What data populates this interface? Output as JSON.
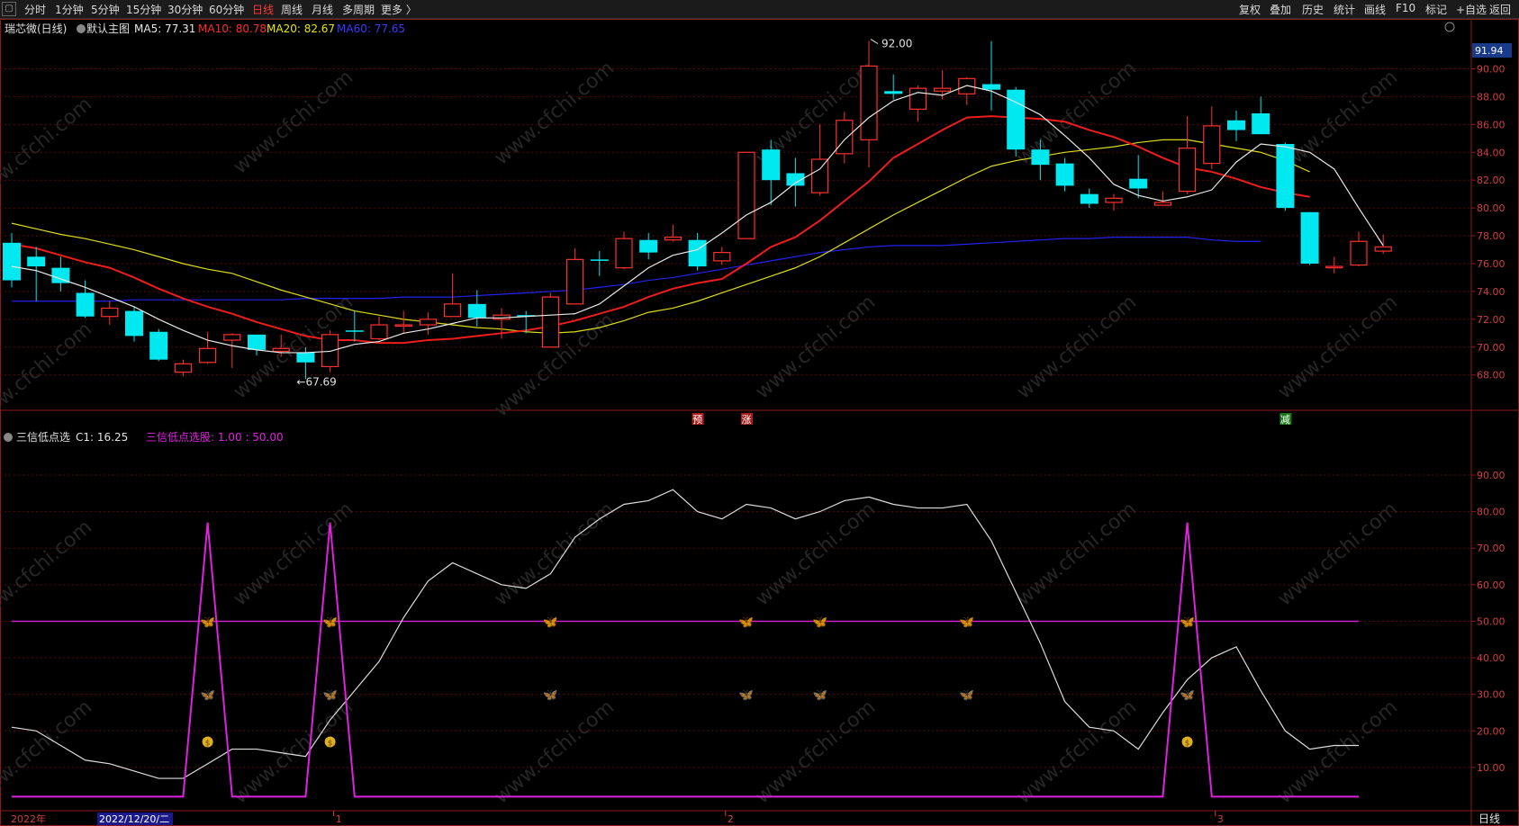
{
  "toolbar": {
    "periods": [
      "分时",
      "1分钟",
      "5分钟",
      "15分钟",
      "30分钟",
      "60分钟",
      "日线",
      "周线",
      "月线",
      "多周期",
      "更多 〉"
    ],
    "active_period": "日线",
    "right_buttons": [
      "复权",
      "叠加",
      "历史",
      "统计",
      "画线",
      "F10",
      "标记",
      "+自选",
      "返回"
    ]
  },
  "main_panel": {
    "stock_name": "瑞芯微(日线)",
    "template": "默认主图",
    "ma_labels": [
      {
        "text": "MA5: 77.31",
        "color": "#e8e8e8"
      },
      {
        "text": "MA10: 80.78",
        "color": "#ff2a2a"
      },
      {
        "text": "MA20: 82.67",
        "color": "#e8e800"
      },
      {
        "text": "MA60: 77.65",
        "color": "#3a3aff"
      }
    ],
    "current_price_tag": "91.94",
    "y_axis_labels": [
      "90.00",
      "88.00",
      "86.00",
      "84.00",
      "82.00",
      "80.00",
      "78.00",
      "76.00",
      "74.00",
      "72.00",
      "70.00",
      "68.00"
    ],
    "high_annotation": "92.00",
    "low_annotation": "67.69",
    "event_markers": [
      {
        "text": "预",
        "index": 28
      },
      {
        "text": "涨",
        "index": 30
      },
      {
        "text": "减",
        "index": 52
      }
    ]
  },
  "sub_panel": {
    "indicator_name": "三信低点选",
    "c1_label": "C1: 16.25",
    "signal_label": "三信低点选股: 1.00 : 50.00",
    "y_axis_labels": [
      "90.00",
      "80.00",
      "70.00",
      "60.00",
      "50.00",
      "40.00",
      "30.00",
      "20.00",
      "10.00"
    ],
    "reference_line": 50
  },
  "x_axis": {
    "year_label": "2022年",
    "cursor_date": "2022/12/20/二",
    "month_ticks": [
      {
        "text": "1",
        "index": 13
      },
      {
        "text": "2",
        "index": 29
      },
      {
        "text": "3",
        "index": 49
      }
    ],
    "period_button": "日线"
  },
  "watermark": "www.cfchi.com",
  "chart_data": {
    "type": "candlestick",
    "ylim": [
      67,
      93
    ],
    "candles": [
      {
        "o": 77.5,
        "h": 78.2,
        "c": 74.8,
        "l": 74.3
      },
      {
        "o": 76.5,
        "h": 77.2,
        "c": 75.8,
        "l": 73.3
      },
      {
        "o": 75.7,
        "h": 76.5,
        "c": 74.6,
        "l": 74.0
      },
      {
        "o": 73.9,
        "h": 74.8,
        "c": 72.2,
        "l": 72.1
      },
      {
        "o": 72.2,
        "h": 73.3,
        "c": 72.8,
        "l": 71.6
      },
      {
        "o": 72.6,
        "h": 72.9,
        "c": 70.8,
        "l": 70.4
      },
      {
        "o": 71.1,
        "h": 71.3,
        "c": 69.1,
        "l": 69.0
      },
      {
        "o": 68.2,
        "h": 69.1,
        "c": 68.8,
        "l": 67.9
      },
      {
        "o": 68.9,
        "h": 71.1,
        "c": 69.9,
        "l": 68.8
      },
      {
        "o": 70.5,
        "h": 71.0,
        "c": 70.9,
        "l": 68.5
      },
      {
        "o": 70.9,
        "h": 70.9,
        "c": 69.8,
        "l": 69.4
      },
      {
        "o": 69.7,
        "h": 70.9,
        "c": 69.9,
        "l": 69.3
      },
      {
        "o": 69.6,
        "h": 70.0,
        "c": 68.9,
        "l": 67.7
      },
      {
        "o": 68.6,
        "h": 71.2,
        "c": 70.9,
        "l": 68.2
      },
      {
        "o": 71.2,
        "h": 72.6,
        "c": 71.1,
        "l": 70.4
      },
      {
        "o": 70.6,
        "h": 72.2,
        "c": 71.6,
        "l": 70.5
      },
      {
        "o": 71.6,
        "h": 72.6,
        "c": 71.6,
        "l": 71.0
      },
      {
        "o": 71.6,
        "h": 72.5,
        "c": 72.0,
        "l": 70.9
      },
      {
        "o": 72.2,
        "h": 75.3,
        "c": 73.1,
        "l": 72.3
      },
      {
        "o": 73.1,
        "h": 74.1,
        "c": 72.1,
        "l": 71.5
      },
      {
        "o": 72.0,
        "h": 72.8,
        "c": 72.3,
        "l": 70.6
      },
      {
        "o": 72.3,
        "h": 72.6,
        "c": 72.2,
        "l": 71.0
      },
      {
        "o": 70.0,
        "h": 73.9,
        "c": 73.6,
        "l": 70.0
      },
      {
        "o": 73.1,
        "h": 77.1,
        "c": 76.3,
        "l": 73.2
      },
      {
        "o": 76.3,
        "h": 76.9,
        "c": 76.2,
        "l": 75.1
      },
      {
        "o": 75.7,
        "h": 78.3,
        "c": 77.8,
        "l": 75.6
      },
      {
        "o": 77.7,
        "h": 78.2,
        "c": 76.8,
        "l": 76.3
      },
      {
        "o": 77.7,
        "h": 78.8,
        "c": 77.9,
        "l": 77.6
      },
      {
        "o": 77.7,
        "h": 78.2,
        "c": 75.8,
        "l": 75.5
      },
      {
        "o": 76.2,
        "h": 77.2,
        "c": 76.8,
        "l": 75.9
      },
      {
        "o": 77.8,
        "h": 84.0,
        "c": 84.0,
        "l": 77.8
      },
      {
        "o": 84.2,
        "h": 84.9,
        "c": 82.0,
        "l": 80.2
      },
      {
        "o": 82.5,
        "h": 83.6,
        "c": 81.6,
        "l": 80.1
      },
      {
        "o": 81.1,
        "h": 86.0,
        "c": 83.5,
        "l": 80.9
      },
      {
        "o": 83.9,
        "h": 86.9,
        "c": 86.3,
        "l": 83.2
      },
      {
        "o": 84.9,
        "h": 92.0,
        "c": 90.2,
        "l": 82.9
      },
      {
        "o": 88.4,
        "h": 89.6,
        "c": 88.2,
        "l": 87.8
      },
      {
        "o": 87.1,
        "h": 88.8,
        "c": 88.6,
        "l": 86.2
      },
      {
        "o": 88.4,
        "h": 89.9,
        "c": 88.6,
        "l": 87.8
      },
      {
        "o": 88.2,
        "h": 89.4,
        "c": 89.3,
        "l": 87.4
      },
      {
        "o": 88.9,
        "h": 92.0,
        "c": 88.5,
        "l": 87.0
      },
      {
        "o": 88.5,
        "h": 88.7,
        "c": 84.2,
        "l": 83.7
      },
      {
        "o": 84.2,
        "h": 84.9,
        "c": 83.1,
        "l": 82.0
      },
      {
        "o": 83.2,
        "h": 83.6,
        "c": 81.6,
        "l": 81.2
      },
      {
        "o": 81.0,
        "h": 81.4,
        "c": 80.3,
        "l": 80.0
      },
      {
        "o": 80.4,
        "h": 81.0,
        "c": 80.7,
        "l": 79.8
      },
      {
        "o": 82.1,
        "h": 83.8,
        "c": 81.4,
        "l": 80.7
      },
      {
        "o": 80.2,
        "h": 81.2,
        "c": 80.4,
        "l": 80.2
      },
      {
        "o": 81.2,
        "h": 86.6,
        "c": 84.3,
        "l": 81.0
      },
      {
        "o": 83.2,
        "h": 87.3,
        "c": 85.9,
        "l": 82.8
      },
      {
        "o": 86.3,
        "h": 87.0,
        "c": 85.6,
        "l": 84.8
      },
      {
        "o": 86.8,
        "h": 88.0,
        "c": 85.3,
        "l": 85.3
      },
      {
        "o": 84.6,
        "h": 84.7,
        "c": 80.0,
        "l": 79.8
      },
      {
        "o": 79.7,
        "h": 79.7,
        "c": 76.0,
        "l": 75.9
      },
      {
        "o": 75.7,
        "h": 76.5,
        "c": 75.8,
        "l": 75.3
      },
      {
        "o": 75.9,
        "h": 78.3,
        "c": 77.6,
        "l": 75.8
      },
      {
        "o": 76.9,
        "h": 78.1,
        "c": 77.2,
        "l": 76.7
      }
    ],
    "ma5": [
      75.8,
      75.5,
      74.9,
      74.3,
      73.6,
      72.9,
      72.0,
      71.2,
      70.5,
      70.1,
      69.8,
      69.6,
      69.6,
      69.7,
      70.2,
      70.4,
      71.0,
      71.3,
      71.7,
      72.1,
      72.1,
      72.2,
      72.3,
      72.4,
      73.1,
      74.4,
      75.7,
      76.6,
      77.0,
      78.2,
      79.5,
      80.4,
      81.8,
      82.8,
      84.9,
      86.5,
      87.7,
      88.3,
      88.1,
      88.8,
      88.4,
      87.6,
      86.7,
      85.2,
      83.6,
      81.7,
      80.9,
      80.5,
      80.8,
      81.3,
      83.3,
      84.6,
      84.4,
      84.0,
      82.8,
      80.0,
      77.3
    ],
    "ma10": [
      77.4,
      77.1,
      76.6,
      76.1,
      75.7,
      75.0,
      74.2,
      73.5,
      72.9,
      72.4,
      71.8,
      71.3,
      70.8,
      70.5,
      70.5,
      70.3,
      70.3,
      70.5,
      70.6,
      70.8,
      71.0,
      71.2,
      71.5,
      71.9,
      72.4,
      72.9,
      73.6,
      74.2,
      74.6,
      74.9,
      76.0,
      77.2,
      77.9,
      79.1,
      80.5,
      81.9,
      83.6,
      84.6,
      85.6,
      86.5,
      86.6,
      86.5,
      86.4,
      86.2,
      85.6,
      85.1,
      84.4,
      83.6,
      82.9,
      82.6,
      82.1,
      81.5,
      81.1,
      80.8
    ],
    "ma20": [
      78.9,
      78.5,
      78.1,
      77.8,
      77.4,
      77.0,
      76.5,
      76.0,
      75.6,
      75.3,
      74.7,
      74.1,
      73.6,
      73.1,
      72.6,
      72.3,
      72.0,
      71.8,
      71.6,
      71.4,
      71.3,
      71.1,
      71.0,
      71.1,
      71.4,
      71.9,
      72.5,
      72.8,
      73.3,
      73.9,
      74.5,
      75.1,
      75.7,
      76.5,
      77.5,
      78.5,
      79.5,
      80.4,
      81.3,
      82.2,
      83.0,
      83.4,
      83.7,
      84.0,
      84.2,
      84.4,
      84.7,
      84.9,
      84.9,
      84.6,
      84.3,
      84.0,
      83.4,
      82.6
    ],
    "ma60": [
      73.3,
      73.3,
      73.3,
      73.3,
      73.3,
      73.4,
      73.4,
      73.4,
      73.4,
      73.4,
      73.4,
      73.4,
      73.5,
      73.5,
      73.5,
      73.5,
      73.6,
      73.6,
      73.6,
      73.7,
      73.8,
      73.9,
      74.0,
      74.1,
      74.3,
      74.5,
      74.8,
      75.0,
      75.3,
      75.6,
      75.9,
      76.2,
      76.5,
      76.8,
      77.0,
      77.2,
      77.3,
      77.3,
      77.3,
      77.4,
      77.5,
      77.6,
      77.7,
      77.8,
      77.8,
      77.9,
      77.9,
      77.9,
      77.9,
      77.7,
      77.6,
      77.6
    ],
    "sub": {
      "ylim": [
        0,
        95
      ],
      "c1": [
        21,
        20,
        16,
        12,
        11,
        9,
        7,
        7,
        11,
        15,
        15,
        14,
        13,
        23,
        31,
        39,
        51,
        61,
        66,
        63,
        60,
        59,
        63,
        73,
        78,
        82,
        83,
        86,
        80,
        78,
        82,
        81,
        78,
        80,
        83,
        84,
        82,
        81,
        81,
        82,
        72,
        58,
        44,
        28,
        21,
        20,
        15,
        25,
        34,
        40,
        43,
        31,
        20,
        15,
        16,
        16
      ],
      "signal": [
        2,
        2,
        2,
        2,
        2,
        2,
        2,
        2,
        77,
        2,
        2,
        2,
        2,
        77,
        2,
        2,
        2,
        2,
        2,
        2,
        2,
        2,
        2,
        2,
        2,
        2,
        2,
        2,
        2,
        2,
        2,
        2,
        2,
        2,
        2,
        2,
        2,
        2,
        2,
        2,
        2,
        2,
        2,
        2,
        2,
        2,
        2,
        2,
        77,
        2,
        2,
        2,
        2,
        2,
        2,
        2
      ],
      "gold_butterflies": [
        8,
        13,
        22,
        30,
        33,
        39,
        48
      ],
      "cyan_butterflies": [
        8,
        13,
        22,
        30,
        33,
        39,
        48
      ],
      "money_bags": [
        8,
        13,
        48
      ]
    }
  }
}
